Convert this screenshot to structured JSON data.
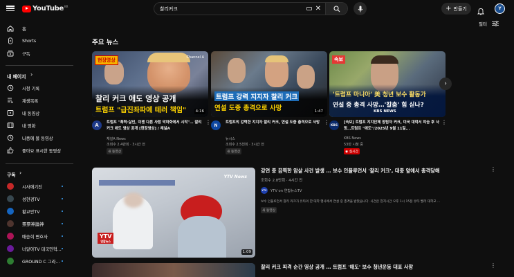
{
  "header": {
    "logo_text": "YouTube",
    "country_code": "KR",
    "search_value": "찰리커크",
    "create_label": "만들기",
    "avatar_initial": "Y"
  },
  "sidebar": {
    "top": [
      {
        "label": "홈",
        "icon": "home-icon"
      },
      {
        "label": "Shorts",
        "icon": "shorts-icon"
      },
      {
        "label": "구독",
        "icon": "subscriptions-icon"
      }
    ],
    "my_heading": "내 페이지",
    "my": [
      {
        "label": "시청 기록",
        "icon": "history-icon"
      },
      {
        "label": "재생목록",
        "icon": "playlists-icon"
      },
      {
        "label": "내 동영상",
        "icon": "your-videos-icon"
      },
      {
        "label": "내 영화",
        "icon": "movies-icon"
      },
      {
        "label": "나중에 볼 동영상",
        "icon": "watch-later-icon"
      },
      {
        "label": "좋아요 표시한 동영상",
        "icon": "liked-icon"
      }
    ],
    "subs_heading": "구독",
    "subs": [
      {
        "label": "시사애기진",
        "color": "#c62828"
      },
      {
        "label": "성현경TV",
        "color": "#37474f"
      },
      {
        "label": "황교안TV",
        "color": "#1565c0"
      },
      {
        "label": "票票神論神",
        "color": "#4e342e"
      },
      {
        "label": "배승희 변호사",
        "color": "#ad1457"
      },
      {
        "label": "너알아TV 대국민혁...",
        "color": "#6a1b9a"
      },
      {
        "label": "GROUND C 그라...",
        "color": "#2e7d32"
      }
    ]
  },
  "main": {
    "filter_label": "필터",
    "section_title": "주요 뉴스",
    "cards": [
      {
        "thumb_tag": "현장영상",
        "thumb_line1": "찰리 커크 애도 영상 공개",
        "thumb_line2": "트럼프 \"급진좌파에 테러 책임\"",
        "thumb_corner": "Channel A",
        "duration": "4:16",
        "title": "트럼프 \"폭력·살인, 이젠 다른 사람 악마화에서 시작\"… 찰리 커크 애도 영상 공개 [현장영상] / 채널A",
        "channel": "채널A News",
        "stats": "조회수 2.4만회 · 3시간 전",
        "badge": "새 동영상",
        "avatar_text": "A"
      },
      {
        "thumb_tag": "",
        "thumb_line1": "트럼프 강력 지지자 찰리 커크",
        "thumb_line2": "연설 도중 총격으로 사망",
        "thumb_corner": "",
        "duration": "1:47",
        "title": "트럼프의 강력한 지지자 찰리 커크, 연설 도중 총격으로 사망",
        "channel": "뉴시스",
        "stats": "조회수 2.5천회 · 3시간 전",
        "badge": "새 동영상",
        "avatar_text": "N"
      },
      {
        "thumb_tag": "속보",
        "thumb_line1": "'트럼프 마니아' 美 청년 보수 활동가",
        "thumb_line2": "연설 중 총격 사망…'칼춤' 힘 싣나?",
        "thumb_corner": "KBS NEWS",
        "duration": "",
        "title": "[속보] 트럼프 지지단체 창립자 커크, 미국 대학서 피습 후 사망…트럼프 \"애도\"/2025년 9월 11일...",
        "channel": "KBS News",
        "stats": "53만 시청 중",
        "badge": "실시간",
        "avatar_text": "KBS"
      }
    ],
    "video": {
      "title": "강연 중 끔찍한 암살 사건 발생 … 보수 인플루언서 '찰리 커크', 대중 앞에서 총격당해",
      "stats": "조회수 2.8만회 · 4시간 전",
      "channel": "YTV on 연합뉴스TV",
      "desc": "보수 인플루언서 찰리 커크가 유타의 한 대학 행사에서 연설 중 총격을 받았습니다. 사건은 현지시간 오후 1시 15분 유타 밸리 대학교 ...",
      "badge": "새 동영상",
      "duration": "1:09",
      "thumb_corner": "YTV News",
      "thumb_logo": "YTV",
      "thumb_logo_sub": "연합뉴스",
      "avatar_text": "YTV",
      "next_title": "찰리 커크 피격 순간 영상 공개 … 트럼프 '애도' 보수 청년운동 대표 사망"
    }
  }
}
